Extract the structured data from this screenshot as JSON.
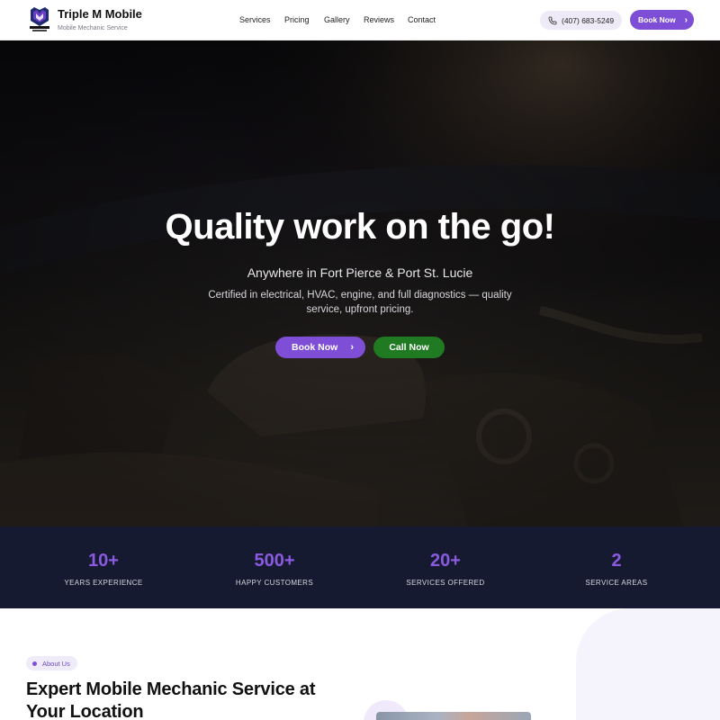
{
  "header": {
    "brand_name": "Triple M Mobile",
    "brand_sub": "Mobile Mechanic Service",
    "nav": [
      "Services",
      "Pricing",
      "Gallery",
      "Reviews",
      "Contact"
    ],
    "phone": "(407) 683-5249",
    "book_label": "Book Now"
  },
  "hero": {
    "title": "Quality work on the go!",
    "subtitle": "Anywhere in Fort Pierce & Port St. Lucie",
    "description": "Certified in electrical, HVAC, engine, and full diagnostics — quality service, upfront pricing.",
    "book_label": "Book Now",
    "call_label": "Call Now"
  },
  "stats": [
    {
      "value": "10+",
      "label": "YEARS EXPERIENCE"
    },
    {
      "value": "500+",
      "label": "HAPPY CUSTOMERS"
    },
    {
      "value": "20+",
      "label": "SERVICES OFFERED"
    },
    {
      "value": "2",
      "label": "SERVICE AREAS"
    }
  ],
  "about": {
    "pill": "About Us",
    "title": "Expert Mobile Mechanic Service at Your Location"
  },
  "colors": {
    "accent": "#7e4fd6",
    "call_green": "#1f7a22",
    "stats_bg": "#151a30"
  },
  "icons": {
    "logo": "shield-logo-icon",
    "phone": "phone-icon",
    "chevron": "chevron-right-icon"
  }
}
